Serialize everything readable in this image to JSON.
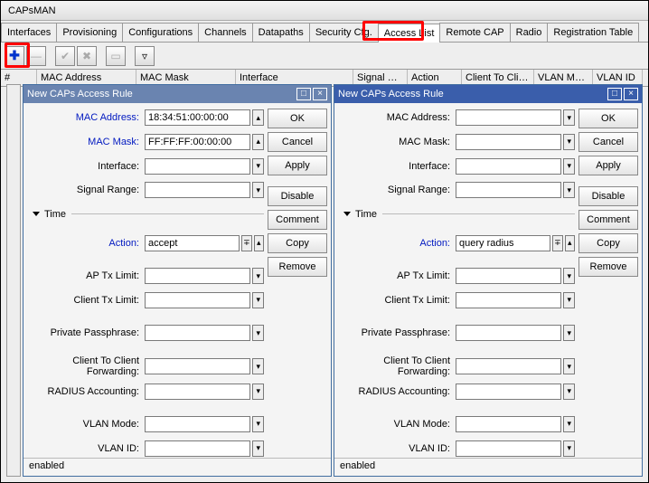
{
  "window": {
    "title": "CAPsMAN"
  },
  "tabs": [
    "Interfaces",
    "Provisioning",
    "Configurations",
    "Channels",
    "Datapaths",
    "Security Cfg.",
    "Access List",
    "Remote CAP",
    "Radio",
    "Registration Table"
  ],
  "active_tab": "Access List",
  "columns": [
    "#",
    "MAC Address",
    "MAC Mask",
    "Interface",
    "Signal Ra...",
    "Action",
    "Client To Clie...",
    "VLAN Mo...",
    "VLAN ID"
  ],
  "dialog_left": {
    "title": "New CAPs Access Rule",
    "fields": {
      "mac_address_label": "MAC Address:",
      "mac_address": "18:34:51:00:00:00",
      "mac_mask_label": "MAC Mask:",
      "mac_mask": "FF:FF:FF:00:00:00",
      "interface_label": "Interface:",
      "interface": "",
      "signal_range_label": "Signal Range:",
      "signal_range": "",
      "time_label": "Time",
      "action_label": "Action:",
      "action": "accept",
      "ap_tx_label": "AP Tx Limit:",
      "ap_tx": "",
      "client_tx_label": "Client Tx Limit:",
      "client_tx": "",
      "passphrase_label": "Private Passphrase:",
      "passphrase": "",
      "ctc_label": "Client To Client Forwarding:",
      "ctc": "",
      "radius_label": "RADIUS Accounting:",
      "radius": "",
      "vlan_mode_label": "VLAN Mode:",
      "vlan_mode": "",
      "vlan_id_label": "VLAN ID:",
      "vlan_id": ""
    },
    "status": "enabled"
  },
  "dialog_right": {
    "title": "New CAPs Access Rule",
    "fields": {
      "mac_address_label": "MAC Address:",
      "mac_address": "",
      "mac_mask_label": "MAC Mask:",
      "mac_mask": "",
      "interface_label": "Interface:",
      "interface": "",
      "signal_range_label": "Signal Range:",
      "signal_range": "",
      "time_label": "Time",
      "action_label": "Action:",
      "action": "query radius",
      "ap_tx_label": "AP Tx Limit:",
      "ap_tx": "",
      "client_tx_label": "Client Tx Limit:",
      "client_tx": "",
      "passphrase_label": "Private Passphrase:",
      "passphrase": "",
      "ctc_label": "Client To Client Forwarding:",
      "ctc": "",
      "radius_label": "RADIUS Accounting:",
      "radius": "",
      "vlan_mode_label": "VLAN Mode:",
      "vlan_mode": "",
      "vlan_id_label": "VLAN ID:",
      "vlan_id": ""
    },
    "status": "enabled"
  },
  "buttons": {
    "ok": "OK",
    "cancel": "Cancel",
    "apply": "Apply",
    "disable": "Disable",
    "comment": "Comment",
    "copy": "Copy",
    "remove": "Remove"
  }
}
